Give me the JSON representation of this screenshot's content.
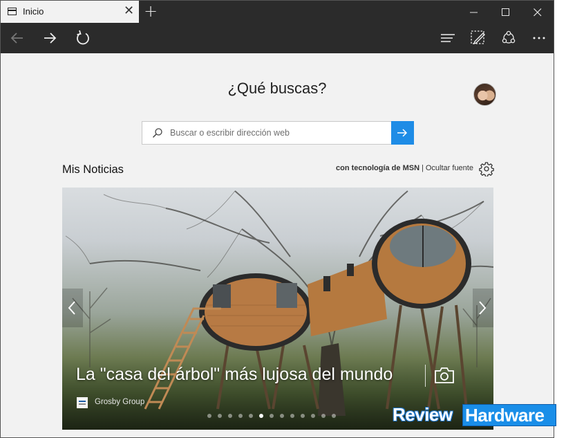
{
  "tab": {
    "title": "Inicio",
    "close_glyph": "✕",
    "new_tab_glyph": "+"
  },
  "window_controls": {
    "minimize": "minimize-icon",
    "maximize": "maximize-icon",
    "close": "close-icon"
  },
  "toolbar": {
    "back": "back-arrow-icon",
    "forward": "forward-arrow-icon",
    "refresh": "refresh-icon",
    "hub": "hub-icon",
    "notes": "web-note-icon",
    "share": "share-icon",
    "more": "more-icon"
  },
  "home": {
    "heading": "¿Qué buscas?",
    "search_placeholder": "Buscar o escribir dirección web"
  },
  "news": {
    "title": "Mis Noticias",
    "powered_by": "con tecnología de MSN",
    "separator": "|",
    "hide_source": "Ocultar fuente"
  },
  "carousel": {
    "headline": "La \"casa del árbol\" más lujosa del mundo",
    "source": "Grosby Group",
    "slide_count": 13,
    "active_index": 5
  },
  "watermark": {
    "part1": "Review",
    "part2": "Hardware"
  },
  "colors": {
    "chrome": "#2b2b2b",
    "page_bg": "#f2f2f2",
    "accent": "#1e8ce6"
  }
}
